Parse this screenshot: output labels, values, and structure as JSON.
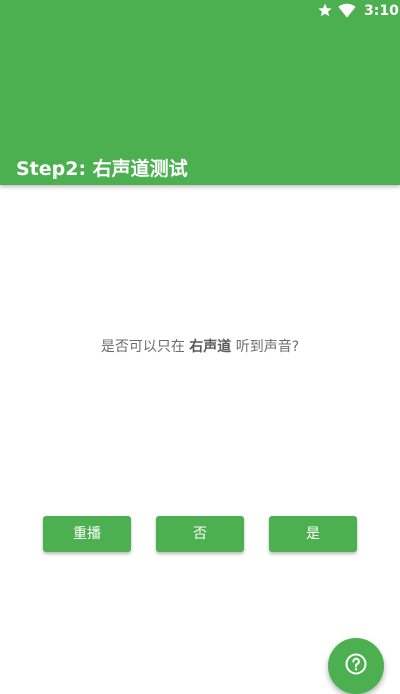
{
  "status_bar": {
    "time": "3:10",
    "icons": [
      "star-icon",
      "wifi-icon"
    ]
  },
  "app_bar": {
    "title": "Step2: 右声道测试",
    "color": "#4caf50"
  },
  "question": {
    "prefix": "是否可以只在 ",
    "emphasis": "右声道",
    "suffix": " 听到声音?"
  },
  "buttons": {
    "replay": "重播",
    "no": "否",
    "yes": "是"
  },
  "fab": {
    "icon": "help-icon"
  }
}
